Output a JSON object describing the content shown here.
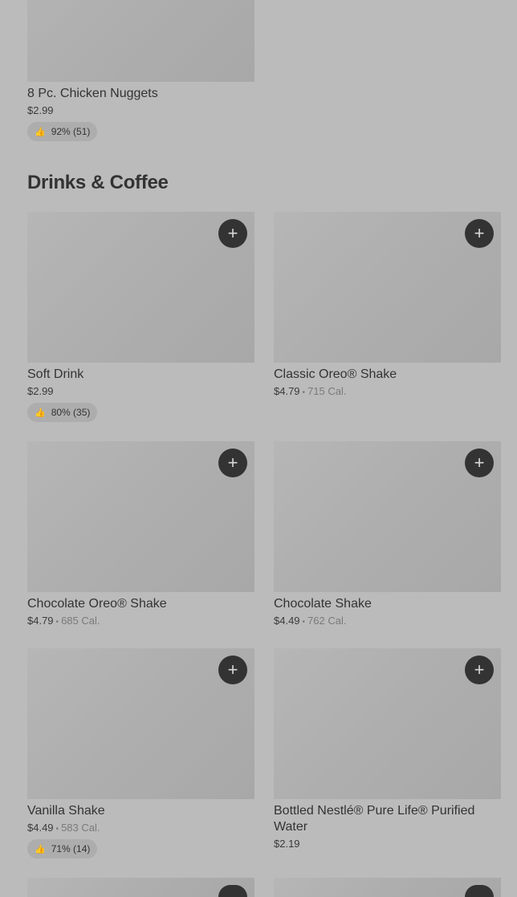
{
  "top_item": {
    "name": "8 Pc. Chicken Nuggets",
    "price": "$2.99",
    "rating": "92% (51)"
  },
  "section": {
    "title": "Drinks & Coffee"
  },
  "items": [
    {
      "name": "Soft Drink",
      "price": "$2.99",
      "calories": "",
      "rating": "80% (35)"
    },
    {
      "name": "Classic Oreo® Shake",
      "price": "$4.79",
      "calories": "715 Cal.",
      "rating": ""
    },
    {
      "name": "Chocolate Oreo® Shake",
      "price": "$4.79",
      "calories": "685 Cal.",
      "rating": ""
    },
    {
      "name": "Chocolate Shake",
      "price": "$4.49",
      "calories": "762 Cal.",
      "rating": ""
    },
    {
      "name": "Vanilla Shake",
      "price": "$4.49",
      "calories": "583 Cal.",
      "rating": "71% (14)"
    },
    {
      "name": "Bottled Nestlé® Pure Life® Purified Water",
      "price": "$2.19",
      "calories": "",
      "rating": ""
    }
  ],
  "icons": {
    "add": "plus-icon",
    "rating": "thumbs-up-icon"
  }
}
